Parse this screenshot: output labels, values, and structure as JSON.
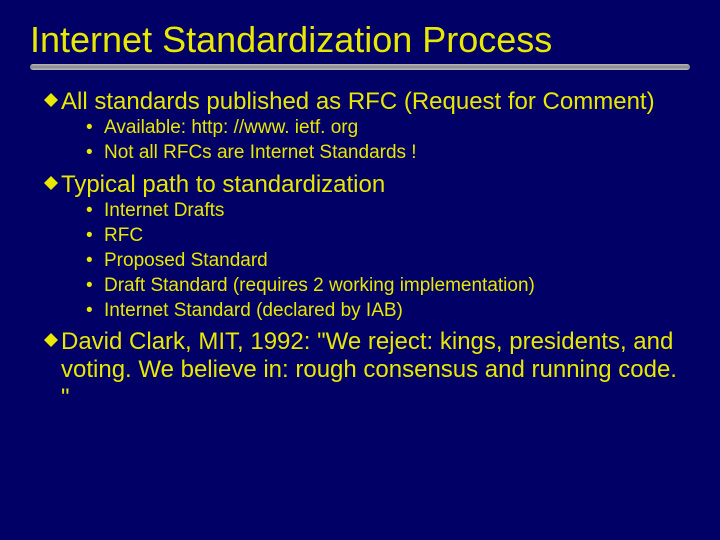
{
  "title": "Internet Standardization Process",
  "points": [
    {
      "text": "All standards published as RFC (Request for Comment)",
      "sub": [
        "Available: http: //www. ietf. org",
        "Not all RFCs are Internet Standards !"
      ]
    },
    {
      "text": "Typical path to standardization",
      "sub": [
        "Internet Drafts",
        "RFC",
        "Proposed Standard",
        "Draft Standard  (requires 2 working implementation)",
        "Internet Standard (declared by IAB)"
      ]
    },
    {
      "text": "David Clark, MIT, 1992: \"We reject: kings, presidents, and voting. We believe in: rough consensus and running code. \"",
      "sub": []
    }
  ]
}
